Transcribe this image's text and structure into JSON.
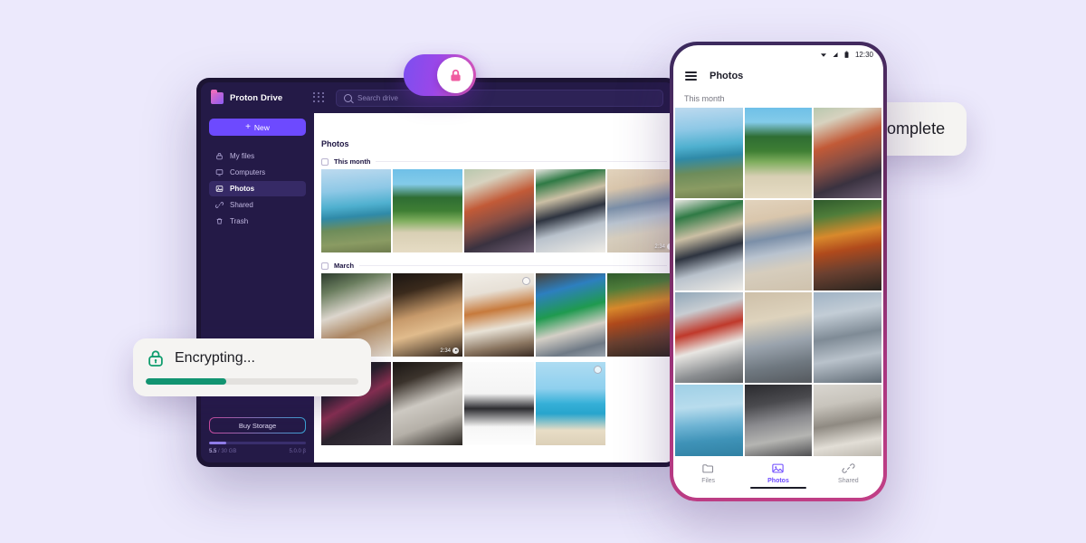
{
  "background_color": "#ece9fc",
  "desktop": {
    "topbar": {
      "brand_name": "Proton Drive",
      "brand_logo_icon": "proton-drive-folder-logo",
      "apps_icon": "apps-grid-icon",
      "search_icon": "search-icon",
      "search_placeholder": "Search drive",
      "search_value": ""
    },
    "sidebar": {
      "new_button_label": "New",
      "new_button_icon": "plus-icon",
      "new_button_color": "#6d4aff",
      "items": [
        {
          "label": "My files",
          "icon": "lock-icon",
          "active": false
        },
        {
          "label": "Computers",
          "icon": "monitor-icon",
          "active": false
        },
        {
          "label": "Photos",
          "icon": "image-icon",
          "active": true
        },
        {
          "label": "Shared",
          "icon": "link-icon",
          "active": false
        },
        {
          "label": "Trash",
          "icon": "trash-icon",
          "active": false
        }
      ],
      "buy_storage_label": "Buy Storage",
      "storage_used": "5.5",
      "storage_sep": " / 30 GB",
      "storage_percent": 18,
      "version": "5.0.0 β"
    },
    "main": {
      "title": "Photos",
      "groups": [
        {
          "label": "This month",
          "checkbox_checked": false
        },
        {
          "label": "March",
          "checkbox_checked": false
        }
      ],
      "video_badges": [
        {
          "duration": "2:34",
          "row": "this-month",
          "index": 4
        },
        {
          "duration": "2:34",
          "row": "march",
          "index": 1
        }
      ]
    }
  },
  "lock_toggle": {
    "state": "on",
    "icon": "lock-icon",
    "track_gradient_from": "#7c4ff0",
    "track_gradient_to": "#e35bb9",
    "knob_icon_color": "#ef5ba0"
  },
  "toasts": [
    {
      "id": "encrypting",
      "icon": "lock-icon",
      "icon_color": "#0f9d6e",
      "text": "Encrypting...",
      "progress_percent": 38,
      "progress_color": "#129471"
    },
    {
      "id": "backup-complete",
      "icon": "check-circle-icon",
      "icon_color": "#0f9d6e",
      "text": "Backup complete"
    }
  ],
  "phone": {
    "status_bar": {
      "wifi_icon": "wifi-icon",
      "signal_icon": "signal-icon",
      "battery_icon": "battery-icon",
      "time": "12:30"
    },
    "appbar": {
      "menu_icon": "hamburger-menu-icon",
      "title": "Photos"
    },
    "section_label": "This month",
    "bottom_nav": [
      {
        "label": "Files",
        "icon": "folder-icon",
        "active": false
      },
      {
        "label": "Photos",
        "icon": "image-icon",
        "active": true
      },
      {
        "label": "Shared",
        "icon": "link-icon",
        "active": false
      }
    ],
    "active_nav_color": "#6d4aff"
  }
}
